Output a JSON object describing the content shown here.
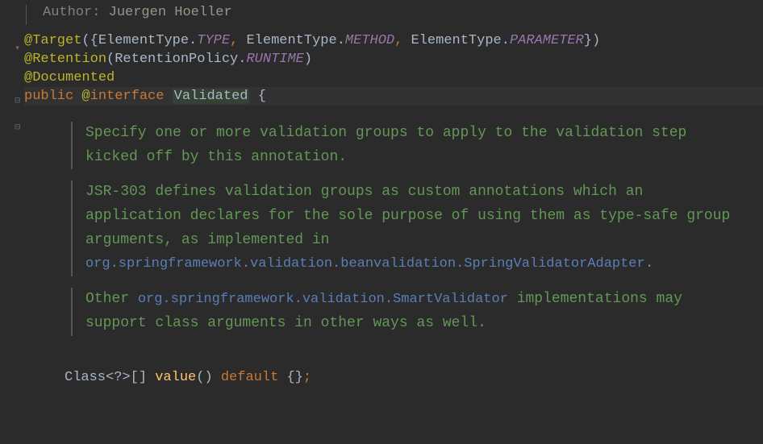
{
  "author": {
    "label": "Author:",
    "name": "Juergen Hoeller"
  },
  "code": {
    "target": {
      "annotation": "@Target",
      "open": "({",
      "type1": "ElementType",
      "const1": "TYPE",
      "type2": "ElementType",
      "const2": "METHOD",
      "type3": "ElementType",
      "const3": "PARAMETER",
      "close": "})"
    },
    "retention": {
      "annotation": "@Retention",
      "open": "(",
      "type": "RetentionPolicy",
      "const": "RUNTIME",
      "close": ")"
    },
    "documented": {
      "annotation": "@Documented"
    },
    "declaration": {
      "public": "public",
      "at": "@",
      "interface": "interface",
      "name": "Validated",
      "brace": "{"
    }
  },
  "javadoc": {
    "p1": "Specify one or more validation groups to apply to the validation step kicked off by this annotation.",
    "p2_a": "JSR-303 defines validation groups as custom annotations which an application declares for the sole purpose of using them as type-safe group arguments, as implemented in ",
    "p2_code": "org.springframework.validation.beanvalidation.SpringValidatorAdapter",
    "p2_b": ".",
    "p3_a": "Other ",
    "p3_code": "org.springframework.validation.SmartValidator",
    "p3_b": " implementations may support class arguments in other ways as well."
  },
  "method": {
    "type": "Class",
    "generic": "<?>[]",
    "name": "value",
    "parens": "()",
    "default": "default",
    "braces": "{}",
    "semi": ";"
  }
}
